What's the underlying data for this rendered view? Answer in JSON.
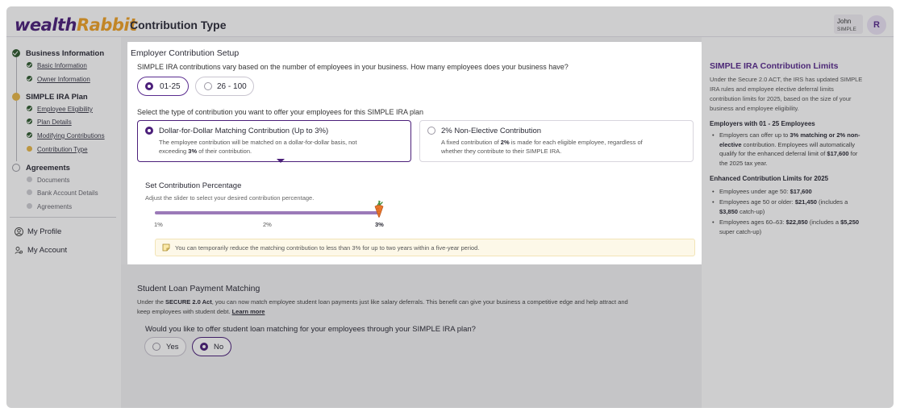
{
  "app": {
    "logo_a": "wealth",
    "logo_b": "Rabbit",
    "title": "Contribution Type"
  },
  "user": {
    "name": "John",
    "plan": "SIMPLE",
    "initial": "R"
  },
  "sidebar": {
    "business": {
      "label": "Business Information",
      "basic": "Basic Information",
      "owner": "Owner Information"
    },
    "ira": {
      "label": "SIMPLE IRA Plan",
      "eligibility": "Employee Eligibility",
      "plan": "Plan Details",
      "modifying": "Modifying Contributions",
      "contribution": "Contribution Type"
    },
    "agreements": {
      "label": "Agreements",
      "documents": "Documents",
      "bank": "Bank Account Details",
      "agreements": "Agreements"
    },
    "profile": "My Profile",
    "account": "My Account"
  },
  "setup": {
    "title": "Employer Contribution Setup",
    "question": "SIMPLE IRA contributions vary based on the number of employees in your business. How many employees does your business have?",
    "size_options": [
      "01-25",
      "26 - 100"
    ],
    "type_prompt": "Select the type of contribution you want to offer your employees for this SIMPLE IRA plan",
    "matching": {
      "title": "Dollar-for-Dollar Matching Contribution (Up to 3%)",
      "desc_line1": "The employee contribution will be matched on a dollar-for-dollar basis, not",
      "desc_line2a": "exceeding ",
      "desc_line2b": "3%",
      "desc_line2c": " of their contribution."
    },
    "nonelective": {
      "title": "2% Non-Elective Contribution",
      "desc_line1a": "A fixed contribution of ",
      "desc_line1b": "2%",
      "desc_line1c": " is made for each eligible employee, regardless of",
      "desc_line2": "whether they contribute to their SIMPLE IRA."
    }
  },
  "slider": {
    "title": "Set Contribution Percentage",
    "hint": "Adjust the slider to select your desired contribution percentage.",
    "ticks": [
      "1%",
      "2%",
      "3%"
    ],
    "min": 1,
    "max": 3,
    "value": 3,
    "note": "You can temporarily reduce the matching contribution to less than 3% for up to two years within a five-year period."
  },
  "student_loan": {
    "title": "Student Loan Payment Matching",
    "desc_a": "Under the ",
    "desc_b": "SECURE 2.0 Act",
    "desc_c": ", you can now match employee student loan payments just like salary deferrals. This benefit can give your business a competitive edge and help attract and",
    "desc_d": "keep employees with student debt. ",
    "learn_more": "Learn more",
    "question": "Would you like to offer student loan matching for your employees through your SIMPLE IRA plan?",
    "yes": "Yes",
    "no": "No"
  },
  "info": {
    "title": "SIMPLE IRA Contribution Limits",
    "intro": [
      "Under the Secure 2.0 ACT, the IRS has updated SIMPLE",
      "IRA rules and employee elective deferral limits",
      "contribution limits for 2025, based on the size of your",
      "business and employee eligibility."
    ],
    "h1": "Employers with 01 - 25 Employees",
    "b1_a": "Employers can offer up to ",
    "b1_b": "3% matching or 2% non-",
    "b1_c": "elective",
    "b1_d": " contribution. Employees will automatically",
    "b1_e": "qualify for the enhanced deferral limit of ",
    "b1_f": "$17,600",
    "b1_g": " for",
    "b1_h": "the 2025 tax year.",
    "h2": "Enhanced Contribution Limits for 2025",
    "b2_a": "Employees under age 50: ",
    "b2_b": "$17,600",
    "b3_a": "Employees age 50 or older: ",
    "b3_b": "$21,450",
    "b3_c": " (includes a",
    "b3_d": "$3,850",
    "b3_e": " catch-up)",
    "b4_a": "Employees ages 60–63: ",
    "b4_b": "$22,850",
    "b4_c": " (includes a ",
    "b4_d": "$5,250",
    "b4_e": "super catch-up)"
  },
  "colors": {
    "brand": "#4b1f7a",
    "accent": "#f0a328",
    "success": "#2f5a2f",
    "note_bg": "#fdf8e8"
  }
}
